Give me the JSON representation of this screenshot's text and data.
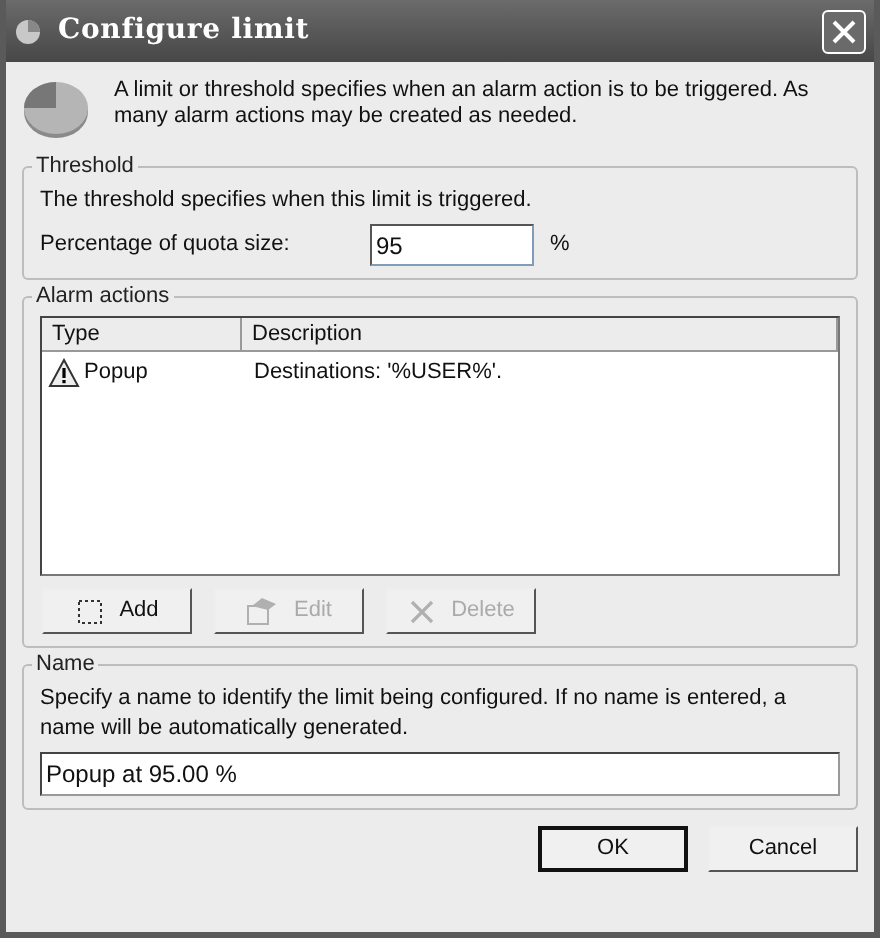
{
  "window": {
    "title": "Configure limit"
  },
  "intro": "A limit or threshold specifies when an alarm action is to be triggered. As many alarm actions may be created as needed.",
  "threshold": {
    "title": "Threshold",
    "description": "The threshold specifies when this limit is triggered.",
    "label": "Percentage of quota size:",
    "value": "95",
    "unit": "%"
  },
  "alarm_actions": {
    "title": "Alarm actions",
    "columns": [
      "Type",
      "Description"
    ],
    "rows": [
      {
        "type": "Popup",
        "description": "Destinations: '%USER%'."
      }
    ],
    "buttons": [
      {
        "label": "Add",
        "disabled": false
      },
      {
        "label": "Edit",
        "disabled": true
      },
      {
        "label": "Delete",
        "disabled": true
      }
    ]
  },
  "name": {
    "title": "Name",
    "description": "Specify a name to identify the limit being configured. If no name is entered, a name will be automatically generated.",
    "value": "Popup at 95.00 %"
  },
  "buttons": [
    {
      "label": "OK",
      "default": true
    },
    {
      "label": "Cancel",
      "default": false
    }
  ]
}
